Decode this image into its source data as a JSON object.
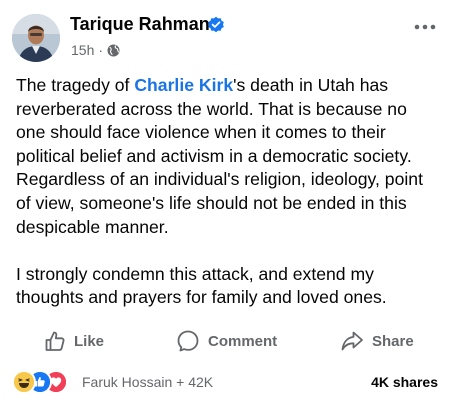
{
  "header": {
    "author_name": "Tarique Rahman",
    "timestamp": "15h",
    "separator": "·",
    "verified_badge": "verified-icon",
    "privacy_icon": "globe-icon",
    "menu_icon": "more-options-icon"
  },
  "post": {
    "paragraph1_before": "The tragedy of ",
    "mention": "Charlie Kirk",
    "paragraph1_after": "'s death in Utah has reverberated across the world. That is because no one should face violence when it comes to their political belief and activism in a democratic society. Regardless of an individual's religion, ideology, point of view, someone's life should not be ended in this despicable manner.",
    "paragraph2": "I strongly condemn this attack, and extend my thoughts and prayers for family and loved ones."
  },
  "actions": {
    "like_label": "Like",
    "comment_label": "Comment",
    "share_label": "Share"
  },
  "footer": {
    "reactions": [
      "haha",
      "like",
      "love"
    ],
    "reactors_text": "Faruk Hossain + 42K",
    "shares_text": "4K shares"
  },
  "colors": {
    "mention": "#1b74e4",
    "verified": "#1877f2",
    "secondary_text": "#65676b",
    "primary_text": "#050505"
  }
}
